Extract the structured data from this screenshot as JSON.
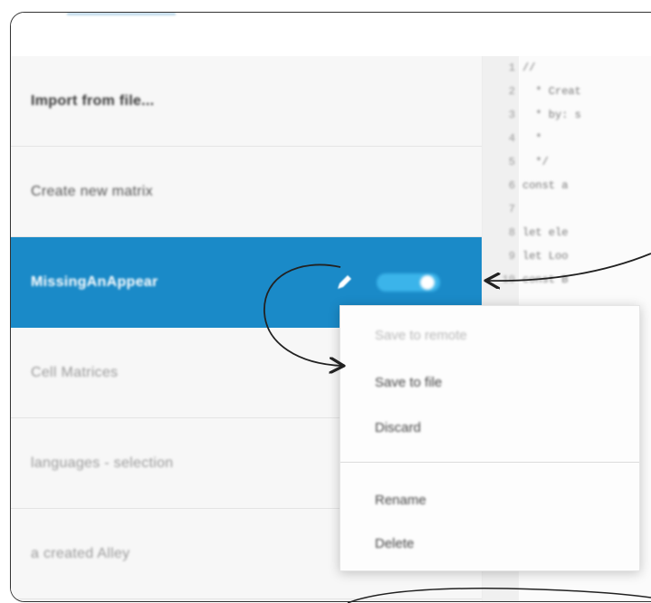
{
  "sidebar": {
    "items": [
      {
        "label": "Import from file...",
        "tone": "dark"
      },
      {
        "label": "Create new matrix",
        "tone": "mid"
      },
      {
        "label": "MissingAnAppear",
        "tone": "selected"
      },
      {
        "label": "Cell Matrices",
        "tone": "light"
      },
      {
        "label": "languages - selection",
        "tone": "light"
      },
      {
        "label": "a created Alley",
        "tone": "light"
      }
    ],
    "selected_toggle_on": true
  },
  "context_menu": {
    "items": [
      {
        "label": "Save to remote",
        "enabled": false
      },
      {
        "label": "Save to file",
        "enabled": true
      },
      {
        "label": "Discard",
        "enabled": true
      },
      {
        "label": "Rename",
        "enabled": true
      },
      {
        "label": "Delete",
        "enabled": true
      }
    ]
  },
  "code": {
    "lines": [
      {
        "n": "1",
        "text": "//"
      },
      {
        "n": "2",
        "text": "  * Creat"
      },
      {
        "n": "3",
        "text": "  * by: s"
      },
      {
        "n": "4",
        "text": "  *"
      },
      {
        "n": "5",
        "text": "  */"
      },
      {
        "n": "6",
        "text": "const a"
      },
      {
        "n": "7",
        "text": ""
      },
      {
        "n": "8",
        "text": "let ele"
      },
      {
        "n": "9",
        "text": "let Loo"
      },
      {
        "n": "10",
        "text": "const B"
      }
    ]
  },
  "colors": {
    "selected_row": "#1a8ac8",
    "toggle": "#3bb4ea"
  }
}
